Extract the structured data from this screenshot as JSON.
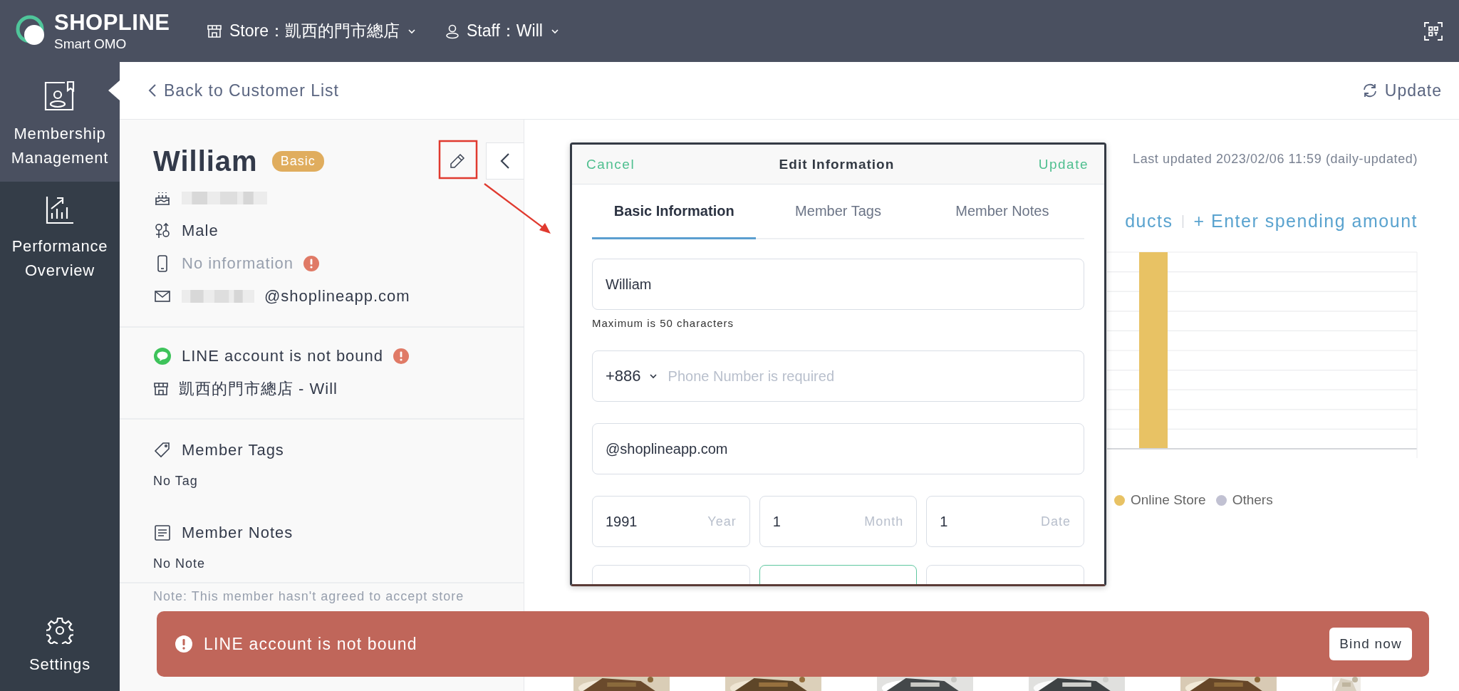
{
  "topbar": {
    "brand": "SHOPLINE",
    "brand_sub": "Smart OMO",
    "store": "Store：凱西的門市總店",
    "staff": "Staff：Will"
  },
  "sidebar": {
    "items": [
      {
        "label": "Membership Management",
        "selected": true
      },
      {
        "label": "Performance Overview",
        "selected": false
      },
      {
        "label": "Settings",
        "selected": false
      }
    ]
  },
  "header": {
    "back": "Back to Customer List",
    "update": "Update"
  },
  "customer": {
    "name": "William",
    "tier": "Basic",
    "gender": "Male",
    "phone": "No information",
    "email_domain": "@shoplineapp.com",
    "line_status": "LINE account is not bound",
    "store_staff": "凱西的門市總店 - Will",
    "tags_title": "Member Tags",
    "tags_value": "No Tag",
    "notes_title": "Member Notes",
    "notes_value": "No Note",
    "note": "Note: This member hasn't agreed to accept store"
  },
  "insights": {
    "last_updated": "Last updated 2023/02/06 11:59 (daily-updated)",
    "products_link": "ducts",
    "spending_link": "+ Enter spending amount",
    "legend": [
      {
        "label": "Online Store",
        "color": "#e8c264"
      },
      {
        "label": "Others",
        "color": "#c1c1d2"
      }
    ]
  },
  "modal": {
    "cancel": "Cancel",
    "title": "Edit Information",
    "update": "Update",
    "tabs": [
      {
        "label": "Basic Information",
        "selected": true
      },
      {
        "label": "Member Tags",
        "selected": false
      },
      {
        "label": "Member Notes",
        "selected": false
      }
    ],
    "name": "William",
    "name_hint": "Maximum is 50 characters",
    "country_code": "+886",
    "phone_placeholder": "Phone Number is required",
    "email": "@shoplineapp.com",
    "birthday": [
      {
        "value": "1991",
        "unit": "Year"
      },
      {
        "value": "1",
        "unit": "Month"
      },
      {
        "value": "1",
        "unit": "Date"
      }
    ],
    "next_row": [
      {
        "focused": false
      },
      {
        "focused": true
      },
      {
        "focused": false
      }
    ]
  },
  "toast": {
    "message": "LINE account is not bound",
    "action": "Bind now"
  }
}
